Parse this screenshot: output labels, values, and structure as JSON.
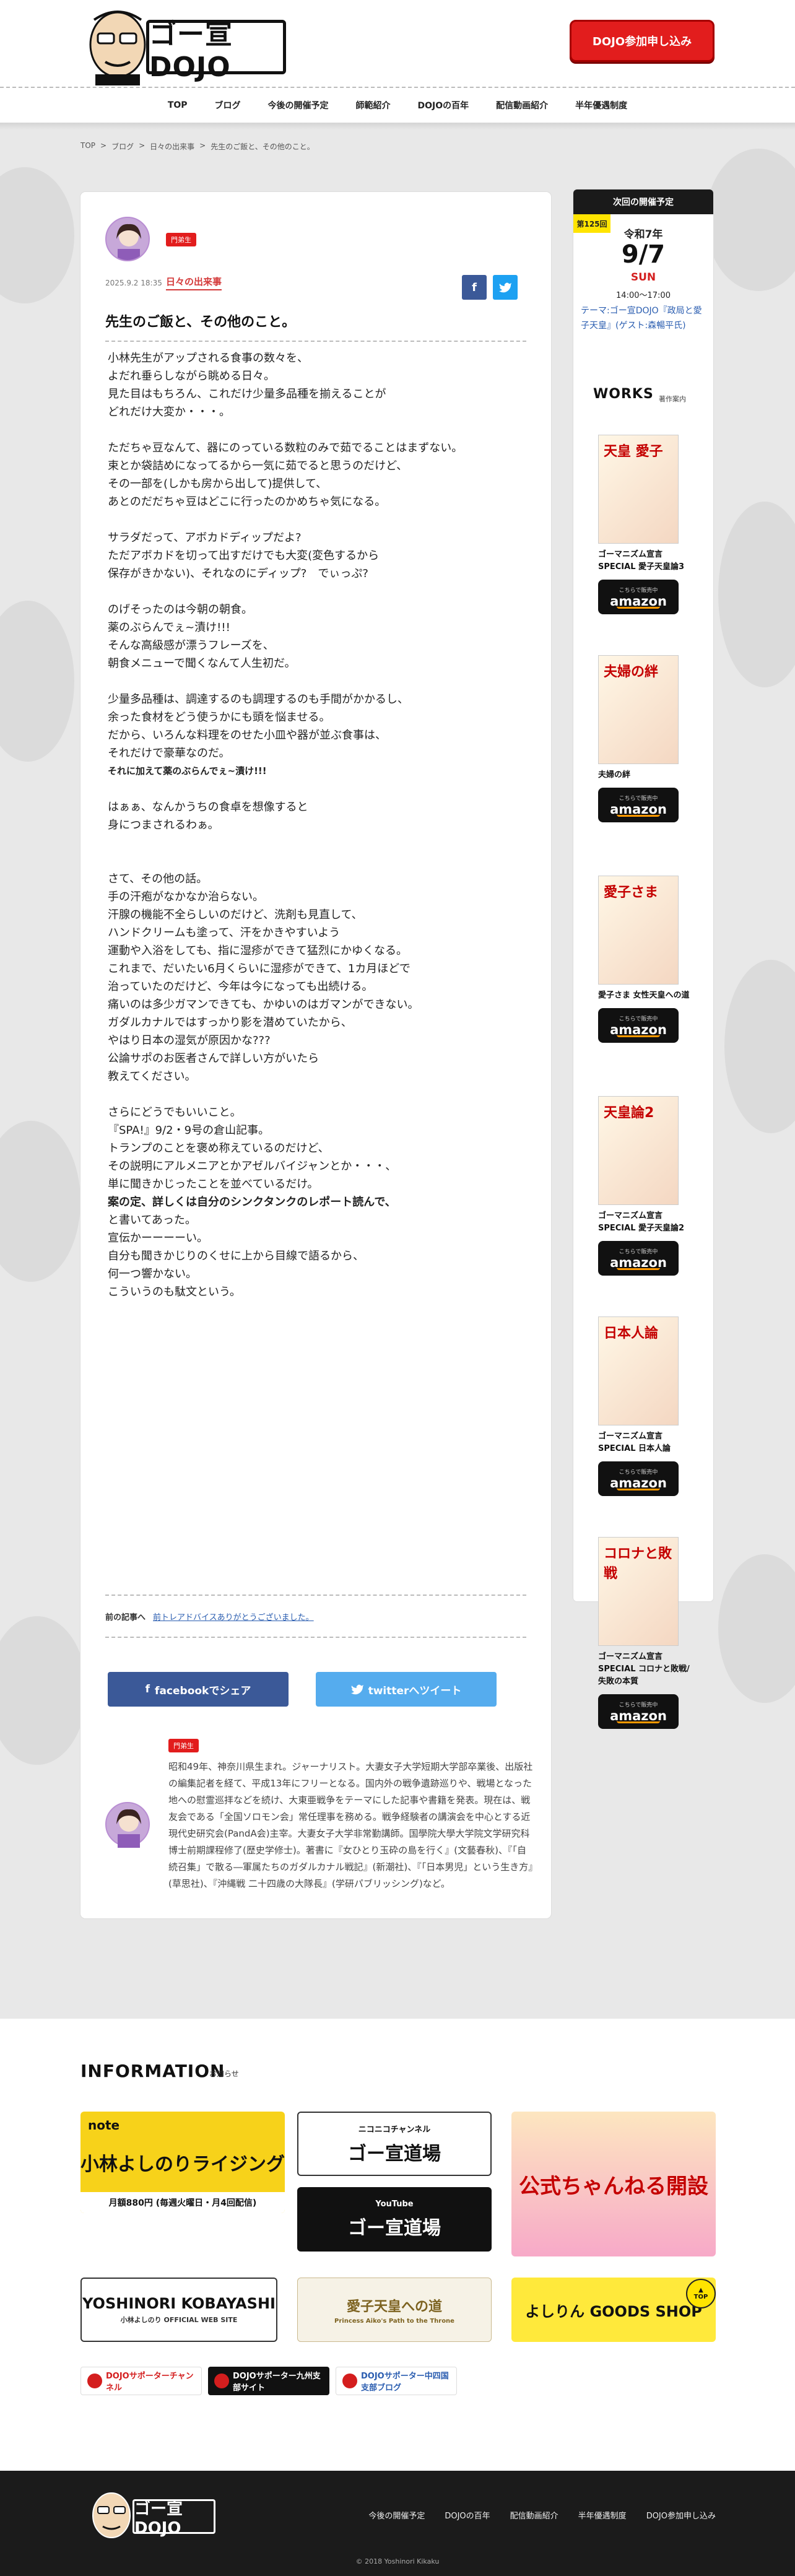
{
  "header": {
    "logo_text": "ゴー宣DOJO",
    "join_button": "DOJO参加申し込み"
  },
  "nav": {
    "items": [
      "TOP",
      "ブログ",
      "今後の開催予定",
      "師範紹介",
      "DOJOの百年",
      "配信動画紹介",
      "半年優遇制度"
    ]
  },
  "breadcrumb": {
    "items": [
      "TOP",
      ">",
      "ブログ",
      ">",
      "日々の出来事",
      ">",
      "先生のご飯と、その他のこと。"
    ]
  },
  "post": {
    "badge": "門弟生",
    "date": "2025.9.2 18:35",
    "category": "日々の出来事",
    "title": "先生のご飯と、その他のこと。",
    "paragraphs": [
      "小林先生がアップされる食事の数々を、\nよだれ垂らしながら眺める日々。\n見た目はもちろん、これだけ少量多品種を揃えることが\nどれだけ大変か・・・。",
      "ただちゃ豆なんて、器にのっている数粒のみで茹でることはまずない。\n束とか袋詰めになってるから一気に茹でると思うのだけど、\nその一部を(しかも房から出して)提供して、\nあとのだだちゃ豆はどこに行ったのかめちゃ気になる。",
      "サラダだって、アボカドディップだよ?\nただアボカドを切って出すだけでも大変(変色するから\n保存がきかない)、それなのにディップ?　でぃっぷ?",
      "のげそったのは今朝の朝食。\n薬のぶらんでぇ~漬け!!!\nそんな高級感が漂うフレーズを、\n朝食メニューで聞くなんて人生初だ。",
      "少量多品種は、調達するのも調理するのも手間がかかるし、\n余った食材をどう使うかにも頭を悩ませる。\nだから、いろんな料理をのせた小皿や器が並ぶ食事は、\nそれだけで豪華なのだ。"
    ],
    "bold_line": "それに加えて薬のぶらんでぇ~漬け!!!",
    "paragraphs2": [
      "はぁぁ、なんかうちの食卓を想像すると\n身につまされるわぁ。",
      "\nさて、その他の話。\n手の汗疱がなかなか治らない。\n汗腺の機能不全らしいのだけど、洗剤も見直して、\nハンドクリームも塗って、汗をかきやすいよう\n運動や入浴をしても、指に湿疹ができて猛烈にかゆくなる。\nこれまで、だいたい6月くらいに湿疹ができて、1カ月ほどで\n治っていたのだけど、今年は今になっても出続ける。\n痛いのは多少ガマンできても、かゆいのはガマンができない。\nガダルカナルではすっかり影を潜めていたから、\nやはり日本の湿気が原因かな???\n公論サポのお医者さんで詳しい方がいたら\n教えてください。",
      "さらにどうでもいいこと。\n『SPA!』9/2・9号の倉山記事。\nトランプのことを褒め称えているのだけど、\nその説明にアルメニアとかアゼルバイジャンとか・・・、\n単に聞きかじったことを並べているだけ。"
    ],
    "bold_line2": "案の定、詳しくは自分のシンクタンクのレポート読んで、",
    "paragraphs3": "と書いてあった。\n宣伝かーーーーい。\n自分も聞きかじりのくせに上から目線で語るから、\n何一つ響かない。\nこういうのも駄文という。",
    "prev_label": "前の記事へ",
    "prev_link": "前トレアドバイスありがとうございました。",
    "share_facebook": "facebookでシェア",
    "share_twitter": "twitterへツイート",
    "author_badge": "門弟生",
    "author_bio": "昭和49年、神奈川県生まれ。ジャーナリスト。大妻女子大学短期大学部卒業後、出版社の編集記者を経て、平成13年にフリーとなる。国内外の戦争遺跡巡りや、戦場となった地への慰霊巡拝などを続け、大東亜戦争をテーマにした記事や書籍を発表。現在は、戦友会である「全国ソロモン会」常任理事を務める。戦争経験者の講演会を中心とする近現代史研究会(PandA会)主宰。大妻女子大学非常勤講師。国學院大學大学院文学研究科博士前期課程修了(歴史学修士)。著書に『女ひとり玉砕の島を行く』(文藝春秋)、『「自続召集」で散る―軍属たちのガダルカナル戦記』(新潮社)、『「日本男児」という生き方』(草思社)、『沖縄戦 二十四歳の大隊長』(学研パブリッシング)など。"
  },
  "sidebar": {
    "next_head": "次回の開催予定",
    "next_badge": "第125回",
    "era": "令和7年",
    "date": "9/7",
    "dow": "SUN",
    "time": "14:00〜17:00",
    "theme": "テーマ:ゴー宣DOJO『政局と愛子天皇』(ゲスト:森暢平氏)",
    "works_head": "WORKS",
    "works_sub": "著作案内",
    "amazon_small": "こちらで販売中",
    "amazon_logo": "amazon",
    "works": [
      {
        "cover": "天皇 愛子",
        "title": "ゴーマニズム宣言SPECIAL 愛子天皇論3"
      },
      {
        "cover": "夫婦の絆",
        "title": "夫婦の絆"
      },
      {
        "cover": "愛子さま",
        "title": "愛子さま 女性天皇への道"
      },
      {
        "cover": "天皇論2",
        "title": "ゴーマニズム宣言SPECIAL 愛子天皇論2"
      },
      {
        "cover": "日本人論",
        "title": "ゴーマニズム宣言SPECIAL 日本人論"
      },
      {
        "cover": "コロナと敗戦",
        "title": "ゴーマニズム宣言SPECIAL コロナと敗戦/失敗の本質"
      }
    ]
  },
  "info": {
    "head": "INFORMATION",
    "sub": "お知らせ",
    "note_logo": "note",
    "note_title": "小林よしのりライジング",
    "note_foot": "月額880円 (毎週火曜日・月4回配信)",
    "nico_top": "ニコニコチャンネル",
    "nico_title": "ゴー宣道場",
    "yt_top": "YouTube",
    "yt_title": "ゴー宣道場",
    "channel_title": "公式ちゃんねる開設",
    "official_title": "YOSHINORI KOBAYASHI",
    "official_sub": "小林よしのり OFFICIAL WEB SITE",
    "aiko_title": "愛子天皇への道",
    "aiko_sub": "Princess Aiko's Path to the Throne",
    "goods_title": "よしりん GOODS SHOP",
    "top_btn": "TOP",
    "sup": [
      "DOJOサポーターチャンネル",
      "DOJOサポーター九州支部サイト",
      "DOJOサポーター中四国支部ブログ"
    ]
  },
  "footer": {
    "logo_text": "ゴー宣DOJO",
    "links": [
      "今後の開催予定",
      "DOJOの百年",
      "配信動画紹介",
      "半年優遇制度",
      "DOJO参加申し込み"
    ],
    "copyright": "© 2018 Yoshinori Kikaku"
  },
  "colors": {
    "brand_red": "#e21d1d",
    "link_blue": "#2a5db0",
    "facebook": "#3b5998",
    "twitter": "#55acee",
    "amazon_orange": "#ff9900"
  }
}
